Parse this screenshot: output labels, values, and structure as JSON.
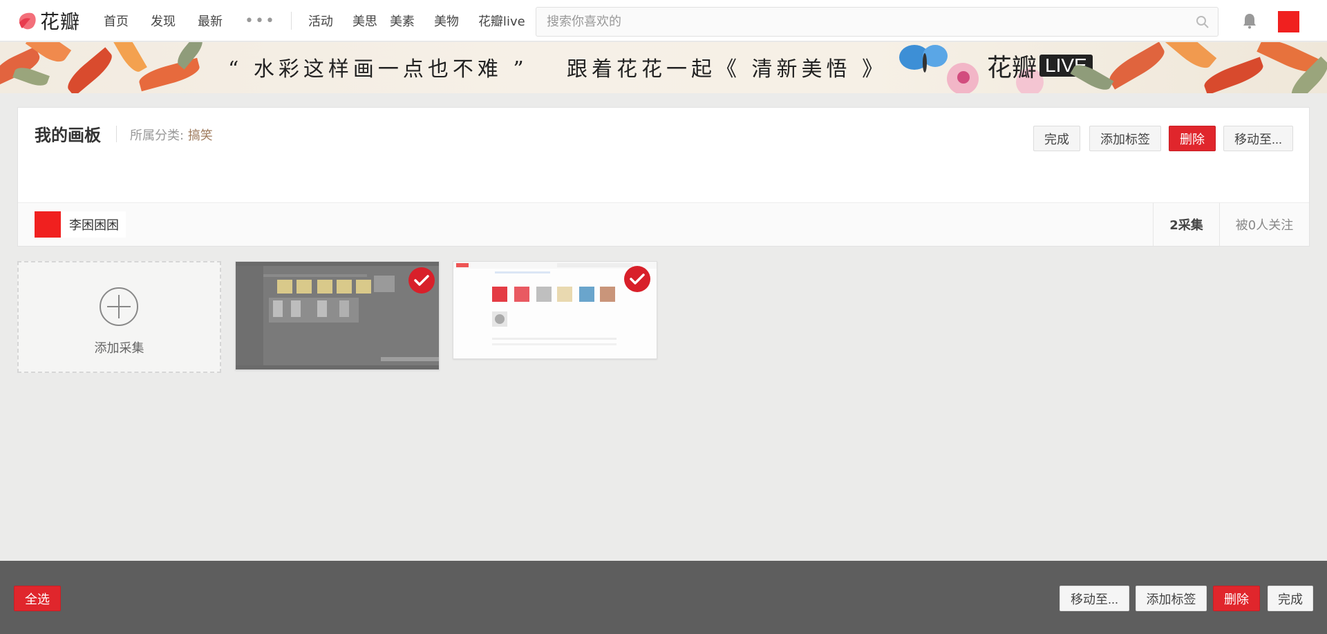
{
  "header": {
    "logo_text": "花瓣",
    "nav": [
      "首页",
      "发现",
      "最新",
      "活动",
      "美思",
      "美素",
      "美物",
      "花瓣live"
    ],
    "more_label": "•••",
    "search_placeholder": "搜索你喜欢的"
  },
  "banner": {
    "headline": "“ 水彩这样画一点也不难 ”",
    "subline": "跟着花花一起《 清新美悟 》",
    "logo_text": "花瓣",
    "logo_badge": "LIVE"
  },
  "board": {
    "title": "我的画板",
    "category_label": "所属分类:",
    "category_value": "搞笑",
    "actions": {
      "done": "完成",
      "add_tag": "添加标签",
      "delete": "删除",
      "move": "移动至..."
    },
    "owner_name": "李困困困",
    "pins_count": "2采集",
    "followers": "被0人关注"
  },
  "pins": {
    "add_label": "添加采集"
  },
  "bottom_bar": {
    "select_all": "全选",
    "move": "移动至...",
    "add_tag": "添加标签",
    "delete": "删除",
    "done": "完成"
  },
  "colors": {
    "brand_red": "#e0262c",
    "avatar_red": "#f0201f",
    "bottom_bar": "#5e5e5e"
  }
}
